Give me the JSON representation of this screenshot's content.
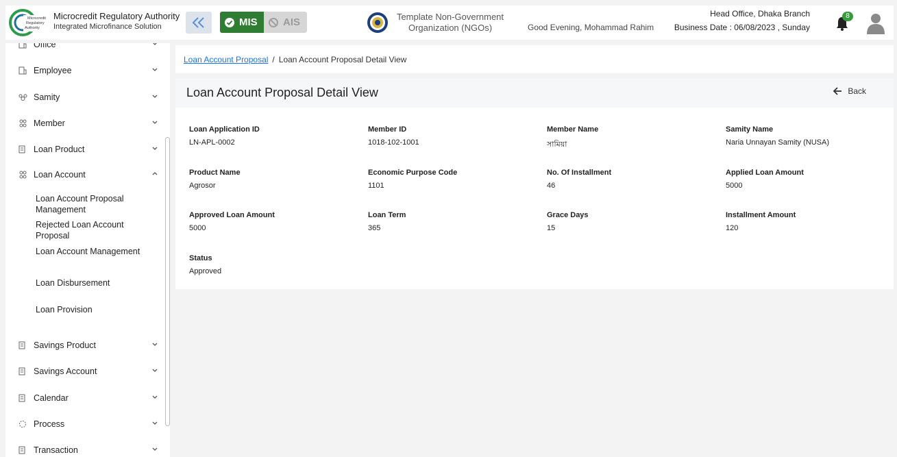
{
  "header": {
    "org_title": "Microcredit Regulatory Authority",
    "org_subtitle": "Integrated Microfinance Solution",
    "logo_text": [
      "Microcredit",
      "Regulatory",
      "Authority"
    ],
    "mis_label": "MIS",
    "ais_label": "AIS",
    "ngo_name_line1": "Template Non-Government",
    "ngo_name_line2": "Organization (NGOs)",
    "greeting": "Good Evening, Mohammad Rahim",
    "branch": "Head Office, Dhaka Branch",
    "business_date": "Business Date : 06/08/2023 , Sunday",
    "notification_count": "8"
  },
  "sidebar": {
    "items": [
      {
        "label": "Office",
        "icon": "office-icon",
        "expanded": false
      },
      {
        "label": "Employee",
        "icon": "employee-icon",
        "expanded": false
      },
      {
        "label": "Samity",
        "icon": "samity-icon",
        "expanded": false
      },
      {
        "label": "Member",
        "icon": "member-icon",
        "expanded": false
      },
      {
        "label": "Loan Product",
        "icon": "document-icon",
        "expanded": false
      },
      {
        "label": "Loan Account",
        "icon": "member-icon",
        "expanded": true
      },
      {
        "label": "Savings Product",
        "icon": "document-icon",
        "expanded": false
      },
      {
        "label": "Savings Account",
        "icon": "document-icon",
        "expanded": false
      },
      {
        "label": "Calendar",
        "icon": "document-icon",
        "expanded": false
      },
      {
        "label": "Process",
        "icon": "process-icon",
        "expanded": false
      },
      {
        "label": "Transaction",
        "icon": "document-icon",
        "expanded": false
      }
    ],
    "loan_account_sub": [
      "Loan Account Proposal Management",
      "Rejected Loan Account Proposal",
      "Loan Account Management",
      "Loan Disbursement",
      "Loan Provision"
    ]
  },
  "breadcrumb": {
    "parent": "Loan Account Proposal",
    "separator": "/",
    "current": "Loan Account Proposal Detail View"
  },
  "panel": {
    "title": "Loan Account Proposal Detail View",
    "back_label": "Back",
    "fields": [
      {
        "label": "Loan Application ID",
        "value": "LN-APL-0002"
      },
      {
        "label": "Member ID",
        "value": "1018-102-1001"
      },
      {
        "label": "Member Name",
        "value": "সামিয়া"
      },
      {
        "label": "Samity Name",
        "value": "Naria Unnayan Samity (NUSA)"
      },
      {
        "label": "Product Name",
        "value": "Agrosor"
      },
      {
        "label": "Economic Purpose Code",
        "value": "1101"
      },
      {
        "label": "No. Of Installment",
        "value": "46"
      },
      {
        "label": "Applied Loan Amount",
        "value": "5000"
      },
      {
        "label": "Approved Loan Amount",
        "value": "5000"
      },
      {
        "label": "Loan Term",
        "value": "365"
      },
      {
        "label": "Grace Days",
        "value": "15"
      },
      {
        "label": "Installment Amount",
        "value": "120"
      },
      {
        "label": "Status",
        "value": "Approved"
      }
    ]
  },
  "colors": {
    "mis_green": "#2e7d32",
    "link_blue": "#1a73e8",
    "badge_green": "#3a9a3e"
  }
}
